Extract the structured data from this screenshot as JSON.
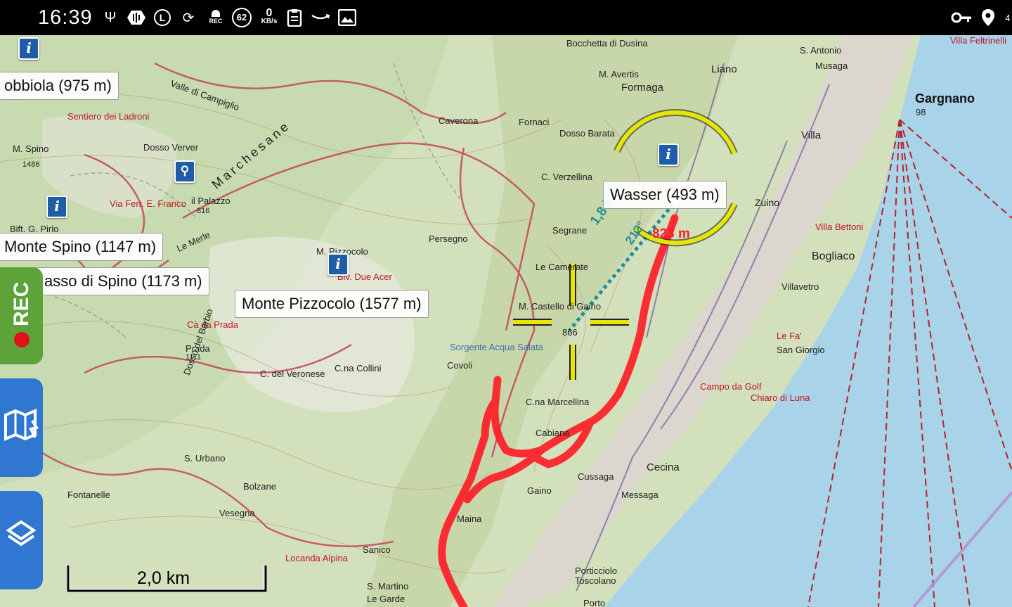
{
  "status_bar": {
    "time": "16:39",
    "notification_count": "62",
    "network_speed_value": "0",
    "network_speed_unit": "KB/s",
    "rec_badge": "REC",
    "letter_badge": "L",
    "right_corner": "4"
  },
  "place_labels": {
    "label_1": "obbiola (975 m)",
    "label_2": "Monte Spino (1147 m)",
    "label_3": "asso di Spino (1173 m)",
    "label_4": "Monte Pizzocolo (1577 m)",
    "label_5": "Wasser (493 m)"
  },
  "measure": {
    "distance": "1,8 km",
    "bearing": "212°",
    "altitude": "823 m"
  },
  "map_names": {
    "gargnano": "Gargnano",
    "gargnano_alt": "98",
    "bogliaco": "Bogliaco",
    "villa_bettoni": "Villa Bettoni",
    "villa_feltrinelli": "Villa Feltrinelli",
    "chiaro_di_luna": "Chiaro di Luna",
    "le_fa": "Le Fa'",
    "san_giorgio": "San Giorgio",
    "porticciolo": "Porticciolo",
    "toscolano": "Toscolano",
    "porto": "Porto",
    "mt_castello": "M. Castello di Gaino",
    "castello_alt": "866",
    "dosso_barata": "Dosso Barata",
    "m_avertis": "M. Avertis",
    "formaga": "Formaga",
    "m_spino": "M. Spino",
    "spino_alt": "1486",
    "dosso_verver": "Dosso Verver",
    "palazzo": "il Palazzo",
    "palazzo_alt": "816",
    "m_pizzocolo": "M. Pizzocolo",
    "biv_due_acer": "Biv. Due Acer",
    "ca_da_prada": "Cà da Prada",
    "prada": "Prada",
    "prada_alt": "1111",
    "cabiana": "Cabiana",
    "gaino": "Gaino",
    "cussaga": "Cussaga",
    "messaga": "Messaga",
    "cecina": "Cecina",
    "sanico": "Sanico",
    "maina": "Maina",
    "locanda_alpina": "Locanda Alpina",
    "s_martino": "S. Martino",
    "le_garde": "Le Garde",
    "sentiero_ladroni": "Sentiero dei Ladroni",
    "valle_campiglio": "Valle di Campiglio",
    "marchesane": "Marchesane",
    "c_verzellina": "C. Verzellina",
    "segrane": "Segrane",
    "le_camerate": "Le Camerate",
    "persegno": "Persegno",
    "sorgente": "Sorgente Acqua Salata",
    "covoli": "Covoli",
    "c_collini": "C.na Collini",
    "c_veronese": "C. del Veronese",
    "campo_golf": "Campo da Golf",
    "villavetro": "Villavetro",
    "zuino": "Zuino",
    "s_antonio": "S. Antonio",
    "musaga": "Musaga",
    "liano": "Liano",
    "villa": "Villa",
    "bocchetta": "Bocchetta di Dusina",
    "caverona": "Caverona",
    "fornaci": "Fornaci",
    "le_merle": "Le Merle",
    "bift_pirlo": "Bift. G. Pirlo",
    "vila_ferr": "Via Ferr. E. Franco",
    "dosso_barbio": "Dosso del Barbio",
    "c_marcellina": "C.na Marcellina",
    "s_urbano": "S. Urbano",
    "fontanelle": "Fontanelle",
    "vesegna": "Vesegna",
    "bolzane": "Bolzane"
  },
  "scale": {
    "label": "2,0 km"
  },
  "side_buttons": {
    "rec_label": "REC"
  },
  "colors": {
    "track": "#ff1e28",
    "lake": "#a9d3e8",
    "rec_button": "#5ea23a",
    "side_button": "#2f77d0",
    "measure_line": "#1e8f9a",
    "crosshair": "#e6e600"
  },
  "icons": [
    "usb-icon",
    "voicemail-icon",
    "sync-icon",
    "rec-icon",
    "clipboard-icon",
    "amazon-icon",
    "image-icon",
    "key-icon",
    "location-icon",
    "info-icon",
    "search-icon",
    "map-mode-icon",
    "layers-icon"
  ]
}
